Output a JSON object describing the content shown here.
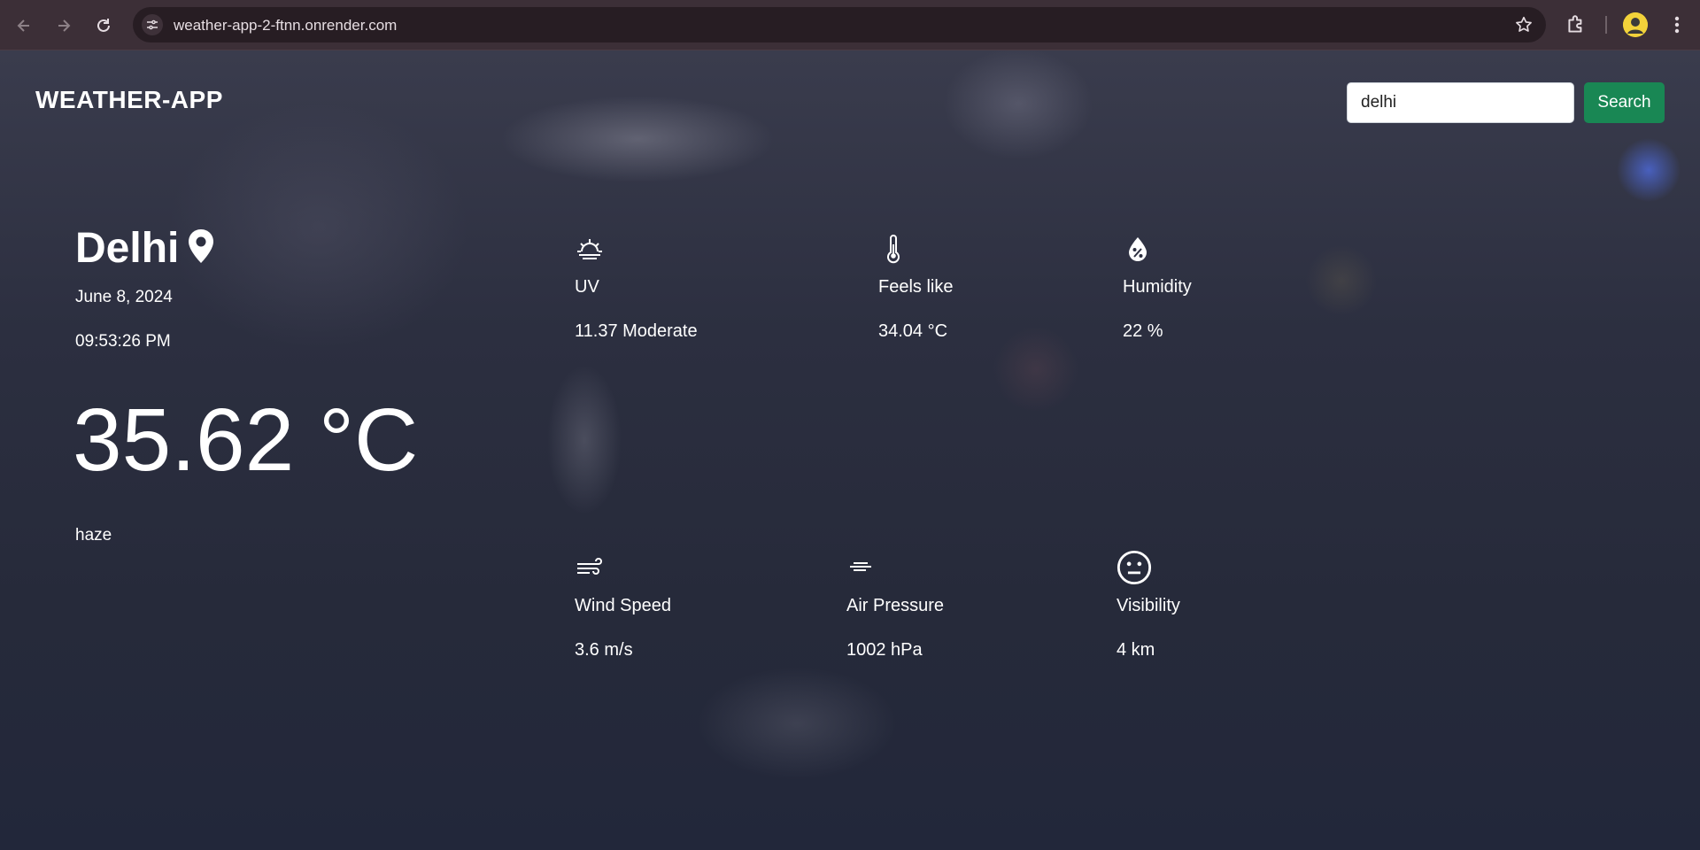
{
  "browser": {
    "url": "weather-app-2-ftnn.onrender.com"
  },
  "app": {
    "brand": "WEATHER-APP",
    "search": {
      "value": "delhi",
      "button_label": "Search"
    }
  },
  "current": {
    "city": "Delhi",
    "date": "June 8, 2024",
    "time": "09:53:26 PM",
    "temperature": "35.62 °C",
    "condition": "haze"
  },
  "stats": [
    {
      "label": "UV",
      "value": "11.37 Moderate",
      "icon": "sunrise-icon"
    },
    {
      "label": "Feels like",
      "value": "34.04 °C",
      "icon": "thermometer-icon"
    },
    {
      "label": "Humidity",
      "value": "22 %",
      "icon": "humidity-drop-icon"
    },
    {
      "label": "Wind Speed",
      "value": "3.6 m/s",
      "icon": "wind-icon"
    },
    {
      "label": "Air Pressure",
      "value": "1002 hPa",
      "icon": "pressure-icon"
    },
    {
      "label": "Visibility",
      "value": "4 km",
      "icon": "neutral-face-icon"
    }
  ],
  "colors": {
    "search_button": "#198754",
    "chrome_bar": "#3c2f37",
    "omnibox": "#271d23"
  }
}
